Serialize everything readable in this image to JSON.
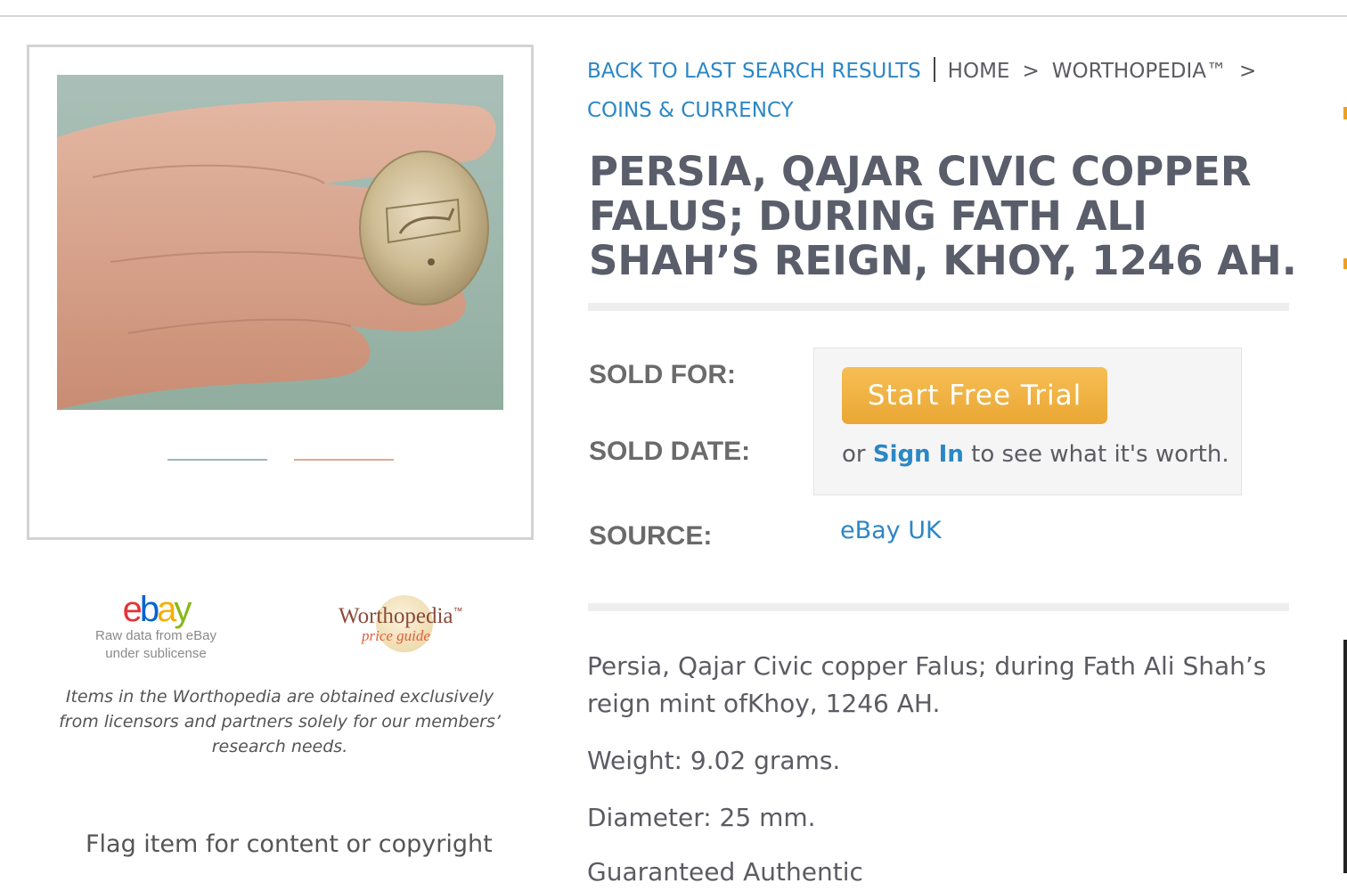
{
  "breadcrumb": {
    "back_link": "BACK TO LAST SEARCH RESULTS",
    "home": "HOME",
    "worthopedia": "WORTHOPEDIA™",
    "category": "COINS & CURRENCY",
    "separator": ">"
  },
  "item": {
    "title": "PERSIA, QAJAR CIVIC COPPER FALUS; DURING FATH ALI SHAH’S REIGN, KHOY, 1246 AH."
  },
  "details": {
    "sold_for_label": "SOLD FOR:",
    "sold_date_label": "SOLD DATE:",
    "source_label": "SOURCE:",
    "source_value": "eBay UK"
  },
  "paywall": {
    "button_label": "Start Free Trial",
    "or_text": "or",
    "signin_label": "Sign In",
    "suffix_text": "to see what it's worth."
  },
  "description": [
    "Persia, Qajar Civic copper Falus; during Fath Ali Shah’s reign mint ofKhoy, 1246 AH.",
    "Weight: 9.02 grams.",
    "Diameter: 25 mm.",
    "Guaranteed Authentic"
  ],
  "sidebar": {
    "ebay_logo": {
      "e": "e",
      "b": "b",
      "a": "a",
      "y": "y"
    },
    "ebay_caption_1": "Raw data from eBay",
    "ebay_caption_2": "under sublicense",
    "worthopedia_logo": "Worthopedia",
    "worthopedia_tm": "™",
    "worthopedia_sub": "price guide",
    "disclaimer": "Items in the Worthopedia are obtained exclusively from licensors and partners solely for our members’ research needs.",
    "flag_link": "Flag item for content or copyright"
  },
  "colors": {
    "link": "#2b87c6",
    "button": "#eaa733",
    "title": "#5a5d6a"
  },
  "icons": [
    "coin-photo",
    "ebay-logo",
    "worthopedia-logo"
  ]
}
